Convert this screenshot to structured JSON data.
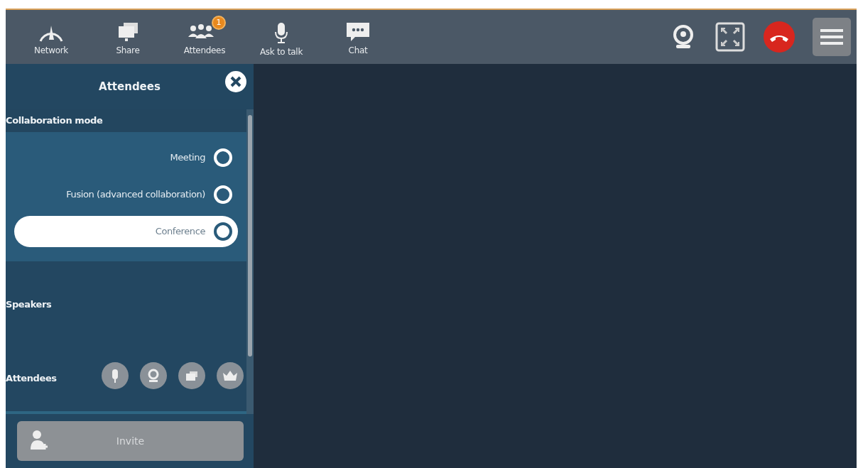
{
  "toolbar": {
    "items": [
      {
        "label": "Network"
      },
      {
        "label": "Share"
      },
      {
        "label": "Attendees",
        "badge": "1"
      },
      {
        "label": "Ask to talk"
      },
      {
        "label": "Chat"
      }
    ]
  },
  "panel": {
    "title": "Attendees",
    "collaboration_mode": {
      "heading": "Collaboration mode",
      "options": [
        {
          "label": "Meeting",
          "selected": false
        },
        {
          "label": "Fusion (advanced collaboration)",
          "selected": false
        },
        {
          "label": "Conference",
          "selected": true
        }
      ]
    },
    "speakers_heading": "Speakers",
    "attendees_heading": "Attendees",
    "invite_button": "Invite"
  }
}
